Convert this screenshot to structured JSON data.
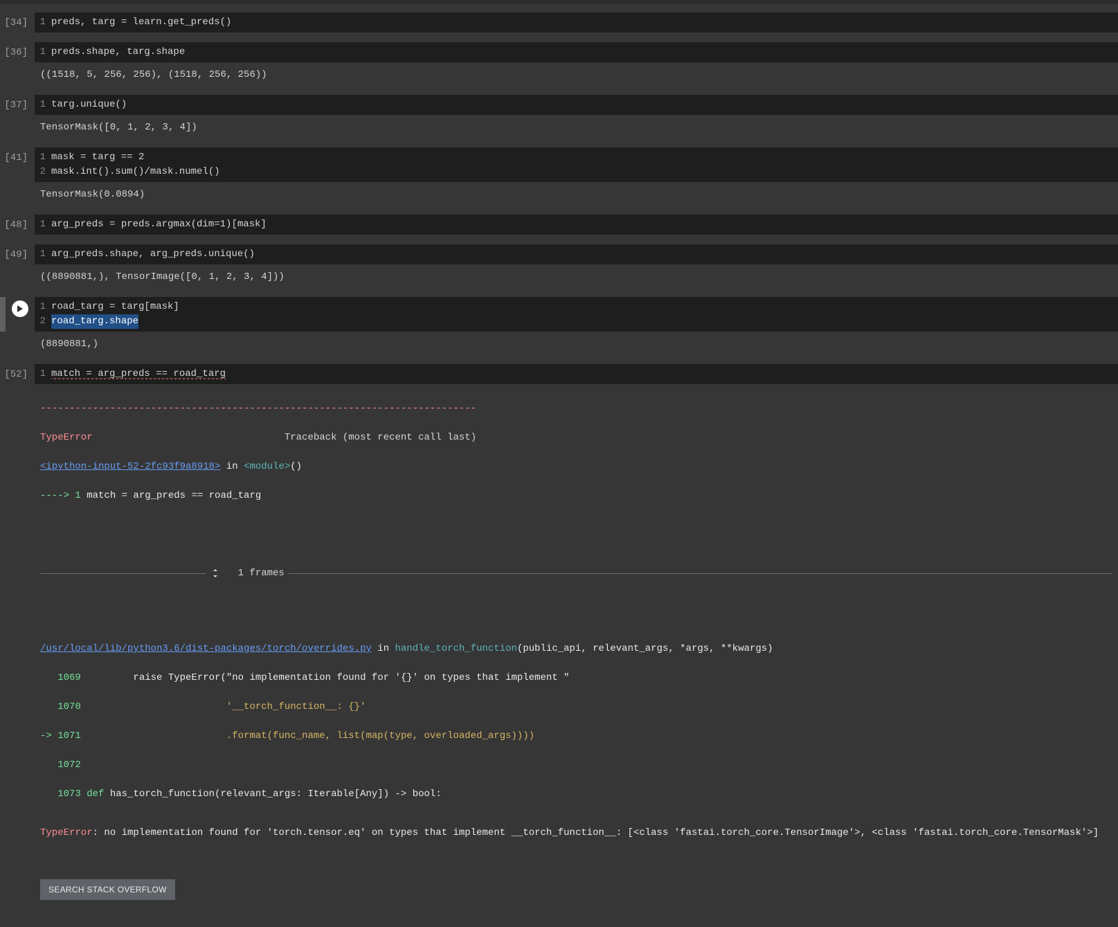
{
  "cells": {
    "c34": {
      "prompt": "[34]",
      "line1": "preds, targ = learn.get_preds()"
    },
    "c36": {
      "prompt": "[36]",
      "line1": "preds.shape, targ.shape",
      "output": "((1518, 5, 256, 256), (1518, 256, 256))"
    },
    "c37": {
      "prompt": "[37]",
      "line1": "targ.unique()",
      "output": "TensorMask([0, 1, 2, 3, 4])"
    },
    "c41": {
      "prompt": "[41]",
      "line1": "mask = targ == 2",
      "line2": "mask.int().sum()/mask.numel()",
      "output": "TensorMask(0.0894)"
    },
    "c48": {
      "prompt": "[48]",
      "line1": "arg_preds = preds.argmax(dim=1)[mask]"
    },
    "c49": {
      "prompt": "[49]",
      "line1": "arg_preds.shape, arg_preds.unique()",
      "output": "((8890881,), TensorImage([0, 1, 2, 3, 4]))"
    },
    "cActive": {
      "line1": "road_targ = targ[mask]",
      "line2": "road_targ.shape",
      "output": "(8890881,)"
    },
    "c52": {
      "prompt": "[52]",
      "line1": "match = arg_preds == road_targ"
    }
  },
  "err": {
    "dashes": "---------------------------------------------------------------------------",
    "name": "TypeError",
    "traceLbl": "                                 Traceback (most recent call last)",
    "ipyLink": "<ipython-input-52-2fc93f9a8918>",
    "inModule": " in ",
    "module": "<module>",
    "parens": "()",
    "arrow1": "----> 1 ",
    "arrow1code": "match = arg_preds == road_targ",
    "framesLabel": "1 frames",
    "fileLink": "/usr/local/lib/python3.6/dist-packages/torch/overrides.py",
    "inFunc": " in ",
    "func": "handle_torch_function",
    "sig": "(public_api, relevant_args, *args, **kwargs)",
    "l1069n": "   1069",
    "l1069": "         raise TypeError(\"no implementation found for '{}' on types that implement \"",
    "l1070n": "   1070",
    "l1070": "                         '__torch_function__: {}'",
    "l1071n": "-> 1071",
    "l1071": "                         .format(func_name, list(map(type, overloaded_args))))",
    "l1072n": "   1072",
    "l1072": "",
    "l1073n": "   1073",
    "l1073pre": " ",
    "l1073def": "def",
    "l1073mid": " has_torch_function(relevant_args: Iterable[Any]) -> bool:",
    "finalName": "TypeError",
    "finalMsg": ": no implementation found for 'torch.tensor.eq' on types that implement __torch_function__: [<class 'fastai.torch_core.TensorImage'>, <class 'fastai.torch_core.TensorMask'>]",
    "soBtn": "SEARCH STACK OVERFLOW"
  }
}
